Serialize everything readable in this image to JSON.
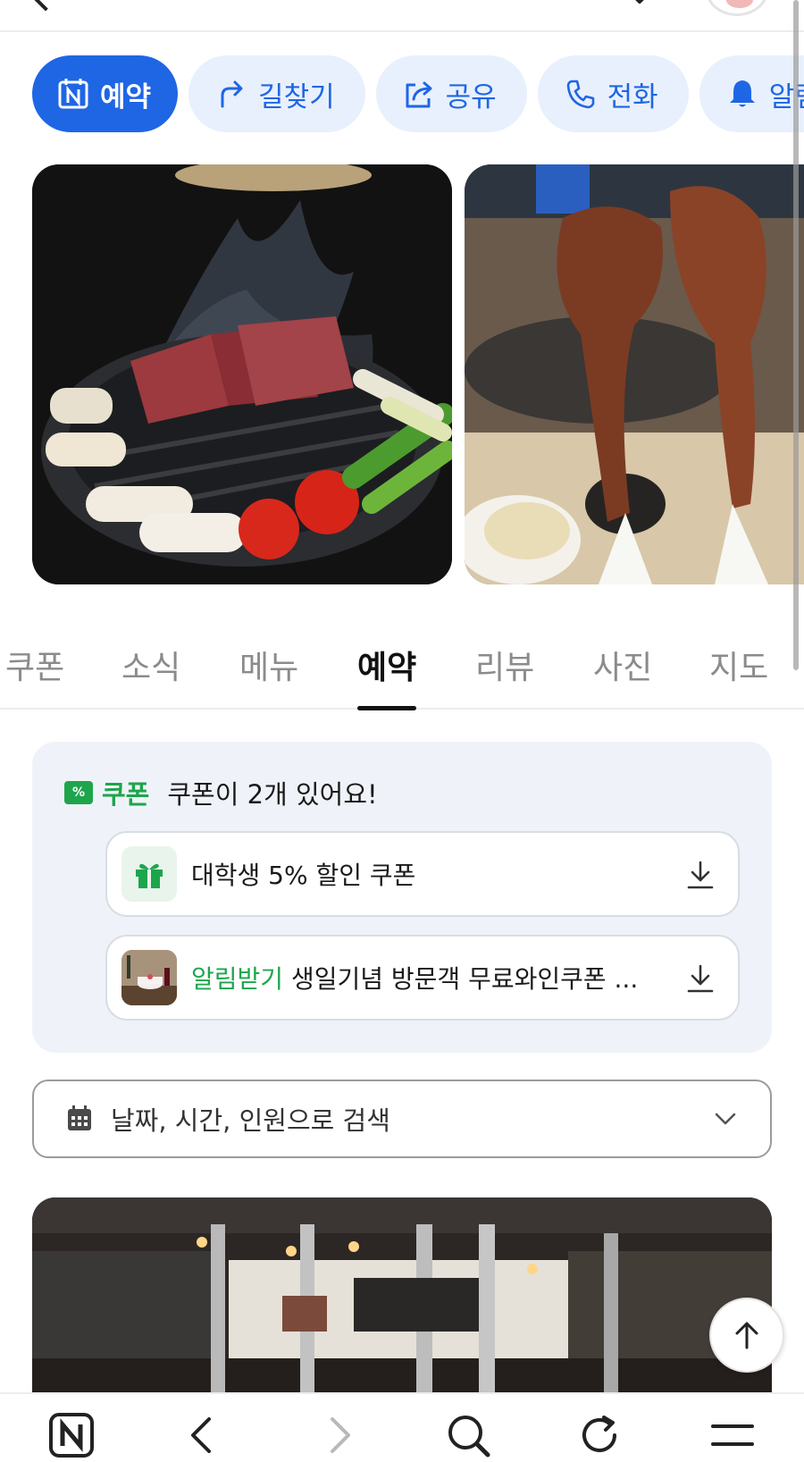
{
  "action_chips": [
    {
      "label": "예약",
      "icon": "calendar-n-icon",
      "primary": true
    },
    {
      "label": "길찾기",
      "icon": "directions-arrow-icon",
      "primary": false
    },
    {
      "label": "공유",
      "icon": "share-icon",
      "primary": false
    },
    {
      "label": "전화",
      "icon": "phone-icon",
      "primary": false
    },
    {
      "label": "알림받기",
      "icon": "bell-icon",
      "primary": false
    }
  ],
  "photos": [
    {
      "alt": "lamb-grill-photo"
    },
    {
      "alt": "lamb-rack-photo"
    }
  ],
  "tabs": [
    {
      "label": "쿠폰",
      "active": false
    },
    {
      "label": "소식",
      "active": false
    },
    {
      "label": "메뉴",
      "active": false
    },
    {
      "label": "예약",
      "active": true
    },
    {
      "label": "리뷰",
      "active": false
    },
    {
      "label": "사진",
      "active": false
    },
    {
      "label": "지도",
      "active": false
    }
  ],
  "coupon": {
    "tag_text": "%",
    "label": "쿠폰",
    "summary": "쿠폰이 2개 있어요!",
    "items": [
      {
        "highlight": "",
        "name": "대학생 5% 할인 쿠폰",
        "icon": "gift-icon"
      },
      {
        "highlight": "알림받기",
        "name": " 생일기념 방문객 무료와인쿠폰 ...",
        "icon": "cake-thumbnail"
      }
    ]
  },
  "search": {
    "placeholder": "날짜, 시간, 인원으로 검색",
    "icon": "calendar-icon"
  },
  "colors": {
    "brand_blue": "#1f66e5",
    "chip_bg": "#e8f0fd",
    "coupon_green": "#1ea54c",
    "coupon_bg": "#eff3f9"
  },
  "bottom_nav": [
    {
      "name": "naver-home",
      "icon": "naver-n-icon"
    },
    {
      "name": "back",
      "icon": "chevron-left-icon"
    },
    {
      "name": "forward",
      "icon": "chevron-right-icon"
    },
    {
      "name": "search",
      "icon": "search-icon"
    },
    {
      "name": "refresh",
      "icon": "refresh-icon"
    },
    {
      "name": "menu",
      "icon": "hamburger-menu-icon"
    }
  ]
}
